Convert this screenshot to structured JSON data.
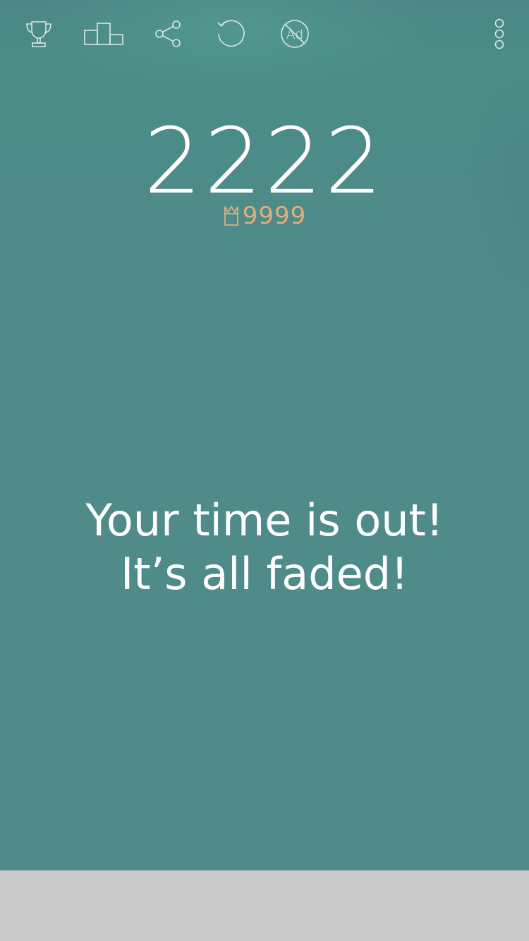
{
  "toolbar": {
    "icons": [
      "trophy-icon",
      "leaderboard-icon",
      "share-icon",
      "restart-icon",
      "no-ads-icon",
      "more-options-icon"
    ],
    "no_ads_label": "Ad",
    "icon_color": "#d8e8e6"
  },
  "game": {
    "score": "2222",
    "best_score": "9999",
    "best_icon": "crown-icon",
    "message_line1": "Your time is out!",
    "message_line2": "It’s all faded!"
  },
  "colors": {
    "background": "#4e8b89",
    "score_text": "#ffffff",
    "best_score_accent": "#e0b07a",
    "ad_banner": "#cacaca"
  }
}
